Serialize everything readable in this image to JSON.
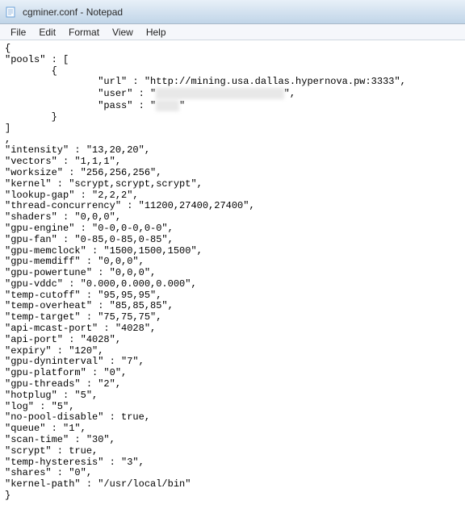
{
  "window": {
    "title": "cgminer.conf - Notepad"
  },
  "menu": {
    "file": "File",
    "edit": "Edit",
    "format": "Format",
    "view": "View",
    "help": "Help"
  },
  "doc": {
    "line00": "{",
    "line01": "\"pools\" : [",
    "line02": "        {",
    "line03": "                \"url\" : \"http://mining.usa.dallas.hypernova.pw:3333\",",
    "line04a": "                \"user\" : \"",
    "line04_redact": "xxxxxxxxxxxxxxxxxxxxxx",
    "line04b": "\",",
    "line05a": "                \"pass\" : \"",
    "line05_redact": "xxxx",
    "line05b": "\"",
    "line06": "        }",
    "line07": "]",
    "line08": ",",
    "line09": "\"intensity\" : \"13,20,20\",",
    "line10": "\"vectors\" : \"1,1,1\",",
    "line11": "\"worksize\" : \"256,256,256\",",
    "line12": "\"kernel\" : \"scrypt,scrypt,scrypt\",",
    "line13": "\"lookup-gap\" : \"2,2,2\",",
    "line14": "\"thread-concurrency\" : \"11200,27400,27400\",",
    "line15": "\"shaders\" : \"0,0,0\",",
    "line16": "\"gpu-engine\" : \"0-0,0-0,0-0\",",
    "line17": "\"gpu-fan\" : \"0-85,0-85,0-85\",",
    "line18": "\"gpu-memclock\" : \"1500,1500,1500\",",
    "line19": "\"gpu-memdiff\" : \"0,0,0\",",
    "line20": "\"gpu-powertune\" : \"0,0,0\",",
    "line21": "\"gpu-vddc\" : \"0.000,0.000,0.000\",",
    "line22": "\"temp-cutoff\" : \"95,95,95\",",
    "line23": "\"temp-overheat\" : \"85,85,85\",",
    "line24": "\"temp-target\" : \"75,75,75\",",
    "line25": "\"api-mcast-port\" : \"4028\",",
    "line26": "\"api-port\" : \"4028\",",
    "line27": "\"expiry\" : \"120\",",
    "line28": "\"gpu-dyninterval\" : \"7\",",
    "line29": "\"gpu-platform\" : \"0\",",
    "line30": "\"gpu-threads\" : \"2\",",
    "line31": "\"hotplug\" : \"5\",",
    "line32": "\"log\" : \"5\",",
    "line33": "\"no-pool-disable\" : true,",
    "line34": "\"queue\" : \"1\",",
    "line35": "\"scan-time\" : \"30\",",
    "line36": "\"scrypt\" : true,",
    "line37": "\"temp-hysteresis\" : \"3\",",
    "line38": "\"shares\" : \"0\",",
    "line39": "\"kernel-path\" : \"/usr/local/bin\"",
    "line40": "}"
  }
}
